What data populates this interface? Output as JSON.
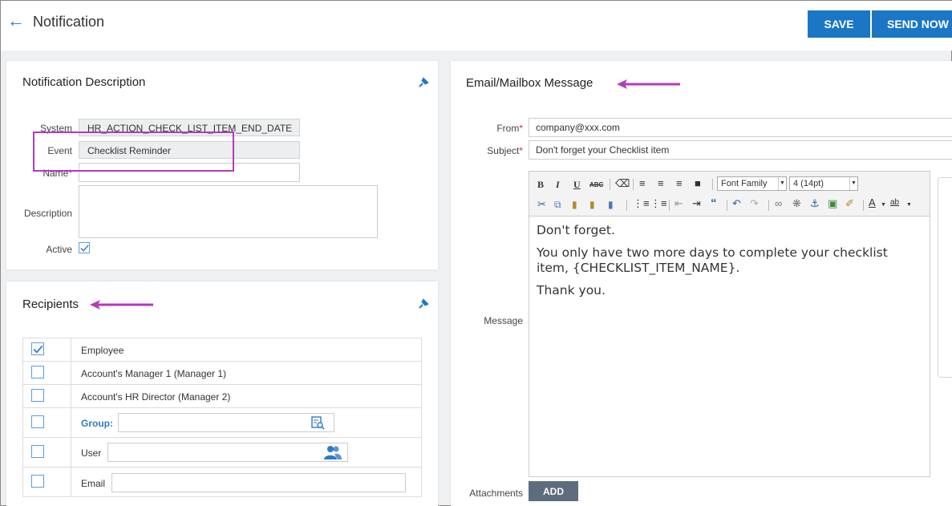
{
  "header": {
    "title": "Notification",
    "save_label": "SAVE",
    "send_now_label": "SEND NOW A"
  },
  "notification_description": {
    "title": "Notification Description",
    "system_label": "System",
    "system_value": "HR_ACTION_CHECK_LIST_ITEM_END_DATE",
    "event_label": "Event",
    "event_value": "Checklist Reminder",
    "name_label": "Name",
    "name_value": "",
    "description_label": "Description",
    "description_value": "",
    "active_label": "Active",
    "active_checked": true
  },
  "recipients": {
    "title": "Recipients",
    "rows": [
      {
        "label": "Employee",
        "checked": true
      },
      {
        "label": "Account's Manager 1 (Manager 1)",
        "checked": false
      },
      {
        "label": "Account's HR Director (Manager 2)",
        "checked": false
      },
      {
        "label": "Group:",
        "checked": false
      },
      {
        "label": "User",
        "checked": false
      },
      {
        "label": "Email",
        "checked": false
      }
    ]
  },
  "email_message": {
    "title": "Email/Mailbox Message",
    "from_label": "From",
    "from_value": "company@xxx.com",
    "subject_label": "Subject",
    "subject_value": "Don't forget your Checklist item",
    "message_label": "Message",
    "font_family_label": "Font Family",
    "font_size_label": "4 (14pt)",
    "body": {
      "line1": "Don't forget.",
      "line2": "You only have two more days to complete your checklist item, {CHECKLIST_ITEM_NAME}.",
      "line3": "Thank you."
    },
    "attachments_label": "Attachments",
    "add_label": "ADD"
  },
  "colors": {
    "primary": "#1c76c6",
    "annotation": "#b13bbd",
    "add_button": "#5d6d7e"
  }
}
